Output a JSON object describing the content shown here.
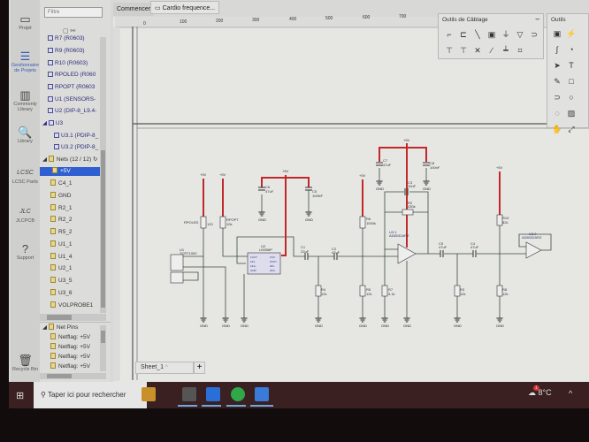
{
  "sidebar_icons": [
    {
      "label": "Projet",
      "icon": "folder-icon"
    },
    {
      "label": "Gestionnaire de Projets",
      "icon": "list-icon"
    },
    {
      "label": "Commonly Library",
      "icon": "chip-icon"
    },
    {
      "label": "Library",
      "icon": "search-chip-icon"
    },
    {
      "label": "LCSC Parts",
      "icon": "lcsc-icon"
    },
    {
      "label": "JLCPCB",
      "icon": "jlc-icon"
    },
    {
      "label": "Support",
      "icon": "help-icon"
    },
    {
      "label": "Recycle Bin",
      "icon": "trash-icon"
    }
  ],
  "tree": {
    "filter_placeholder": "Filtre",
    "components": [
      "R7 (R0603)",
      "R9 (R0603)",
      "R10 (R0603)",
      "RPOLED (R060",
      "RPOPT (R0603",
      "U1 (SENSORS-",
      "U2 (DIP-8_L9.4-",
      "U3",
      "U3.1 (PDIP-8_",
      "U3.2 (PDIP-8_"
    ],
    "nets_header": "Nets (12 / 12)",
    "nets": [
      "+5V",
      "C4_1",
      "GND",
      "R2_1",
      "R2_2",
      "R5_2",
      "U1_1",
      "U1_4",
      "U2_1",
      "U3_5",
      "U3_6",
      "VOLPROBE1"
    ],
    "selected_net": "+5V",
    "net_pins_header": "Net Pins",
    "net_pins": [
      "Netflag: +5V",
      "Netflag: +5V",
      "Netflag: +5V",
      "Netflag: +5V"
    ]
  },
  "tabs": [
    {
      "label": "Commencer"
    },
    {
      "label": "Cardio frequence..."
    }
  ],
  "ruler": [
    "0",
    "100",
    "200",
    "300",
    "400",
    "500",
    "600",
    "700"
  ],
  "wiring_tools": {
    "title": "Outils de Câblage",
    "tools": [
      "wire",
      "bus",
      "line",
      "netport",
      "gnd",
      "netflag",
      "netlabel",
      "vcc",
      "+5v",
      "no-connect",
      "probe",
      "pin",
      "group"
    ]
  },
  "drawing_tools": {
    "title": "Outils"
  },
  "schematic": {
    "vcc": "+5V",
    "gnd": "GND",
    "parts": {
      "RPOLED": "RPOLED",
      "RPOLED_v": "120",
      "RPOPT": "RPOPT",
      "RPOPT_v": "10k",
      "U1": "U1",
      "U1_v": "TCRT1000",
      "U2": "U2",
      "U2_v": "LM358P",
      "C6": "C6",
      "C6_v": "47uF",
      "C5b": "C5",
      "C5b_v": "100NF",
      "C1": "C1",
      "C1_v": "22uF",
      "C2": "C2",
      "C2_v": "47uF",
      "R4": "R4",
      "R4_v": "12k",
      "R6": "R6",
      "R6_v": "1000k",
      "R5": "R5",
      "R5_v": "12k",
      "R7": "R7",
      "R7_v": "5.1k",
      "U3_1": "U3.1",
      "U3_1_v": "AD8032ARZ",
      "C7": "C7",
      "C7_v": "47uF",
      "C8": "C8",
      "C8_v": "100nF",
      "C3": "C3",
      "C3_v": "10nF",
      "R2": "R2",
      "R2_v": "430k",
      "C5": "C5",
      "C5_v": "47uF",
      "C4": "C4",
      "C4_v": "47uF",
      "R3": "R3",
      "R3_v": "12k",
      "R10": "R10",
      "R10_v": "82k",
      "R8": "R8",
      "R8_v": "12k",
      "U3_2": "U3.2",
      "U3_2_v": "AD8032ARZ"
    },
    "u2_pins": [
      "1OUT",
      "1IN-",
      "1IN+",
      "GND",
      "VCC",
      "2OUT",
      "2IN-",
      "2IN+"
    ]
  },
  "sheet_tab": "Sheet_1",
  "add_sheet": "+",
  "taskbar": {
    "search_placeholder": "Taper ici pour rechercher",
    "weather": "8°C",
    "weather_badge": "1"
  },
  "colors": {
    "wire": "#3a4a3a",
    "power_wire": "#c0282a",
    "selection": "#2f5fd0"
  }
}
